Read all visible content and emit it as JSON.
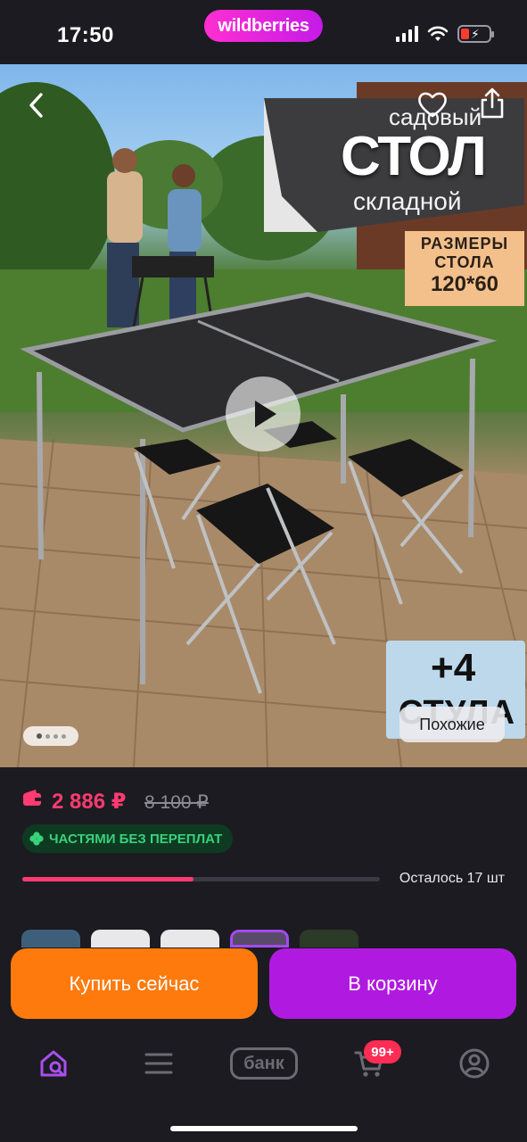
{
  "status_bar": {
    "time": "17:50",
    "brand": "wildberries",
    "icons": [
      "cellular-signal-icon",
      "wifi-icon",
      "battery-low-charging-icon"
    ]
  },
  "gallery": {
    "banner": {
      "top": "садовый",
      "main": "СТОЛ",
      "bottom": "складной"
    },
    "size_plate": {
      "line1": "РАЗМЕРЫ",
      "line2": "СТОЛА",
      "line3": "120*60"
    },
    "similar": {
      "thumb_text_1": "+4",
      "thumb_text_2": "СТУЛА",
      "button_label": "Похожие"
    },
    "pagination": {
      "count": 4,
      "active_index": 0
    },
    "icons": [
      "back-chevron-icon",
      "heart-icon",
      "share-icon",
      "play-icon"
    ]
  },
  "price": {
    "current": "2 886 ₽",
    "old": "8 100 ₽",
    "installment_label": "ЧАСТЯМИ БЕЗ ПЕРЕПЛАТ",
    "stock_label": "Осталось 17 шт",
    "stock_progress": 0.48,
    "accent_color": "#ff3b71",
    "installment_color": "#37d27a"
  },
  "actions": {
    "buy_now": "Купить сейчас",
    "add_to_cart": "В корзину",
    "buy_now_color": "#ff7a0d",
    "add_to_cart_color": "#b01ae0"
  },
  "tabbar": {
    "bank_label": "банк",
    "cart_badge": "99+",
    "icons": [
      "home-search-icon",
      "catalog-menu-icon",
      "bank-icon",
      "cart-icon",
      "profile-icon"
    ]
  }
}
